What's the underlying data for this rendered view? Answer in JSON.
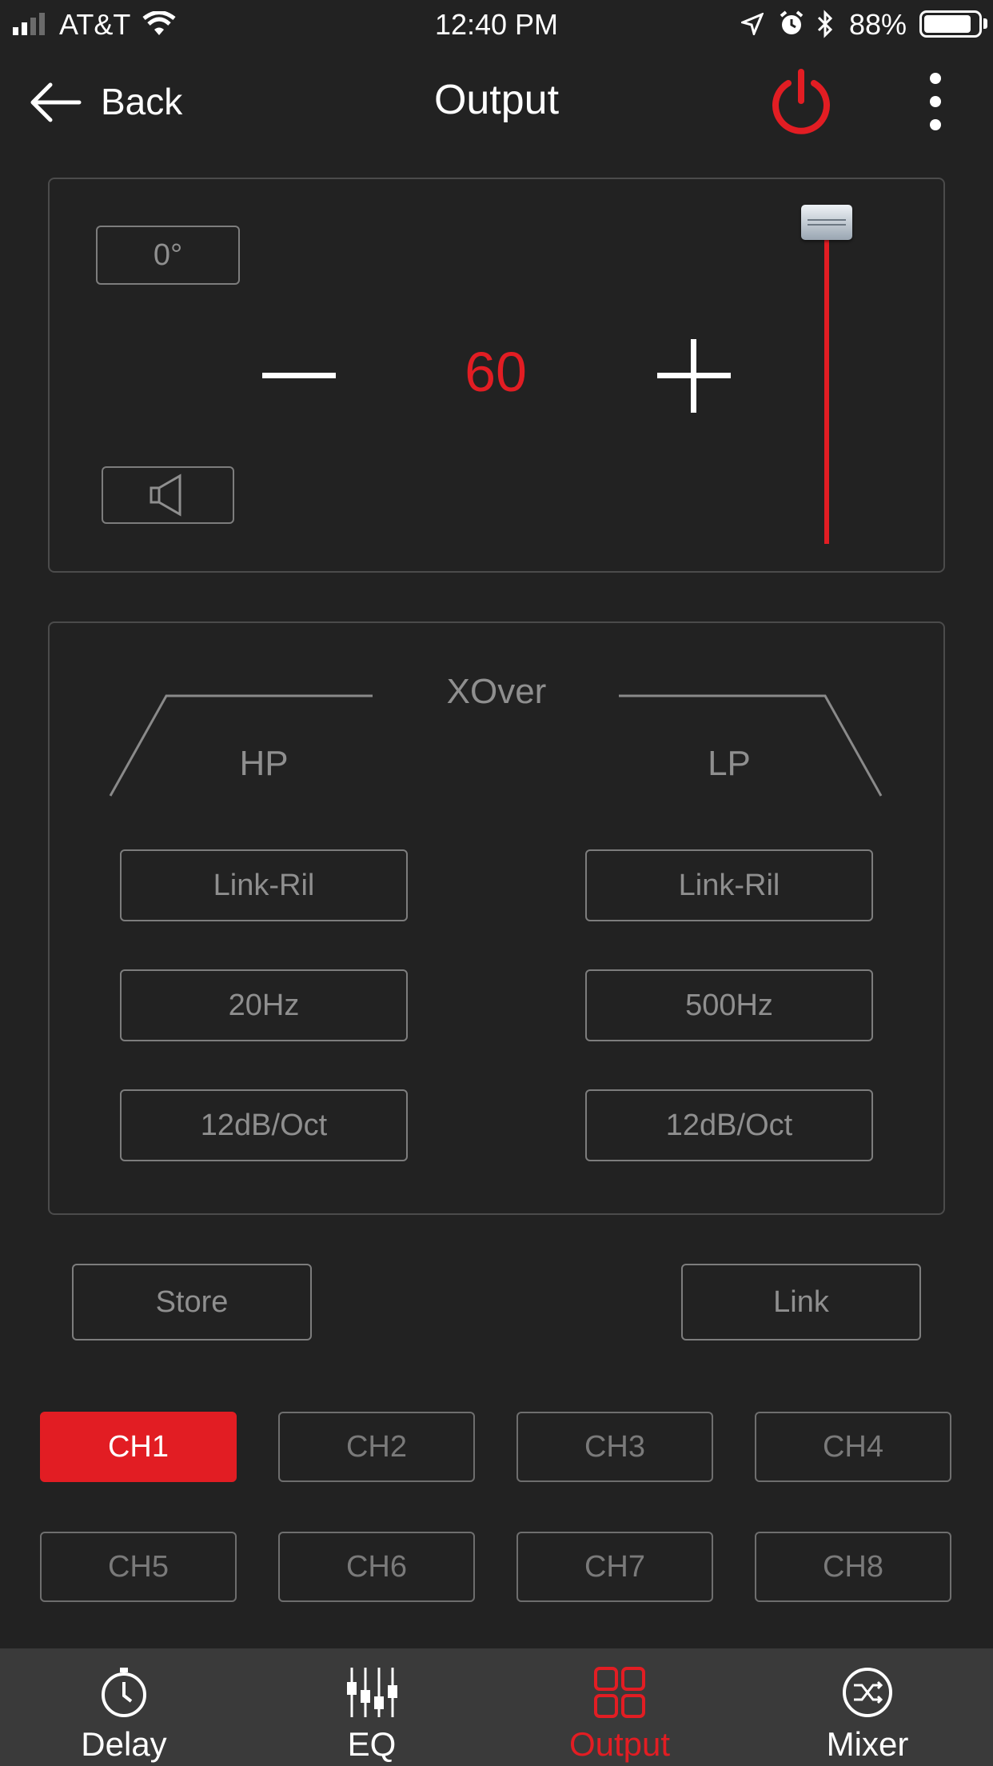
{
  "status_bar": {
    "carrier": "AT&T",
    "time": "12:40 PM",
    "battery": "88%",
    "battery_level": 0.88
  },
  "nav": {
    "back_label": "Back",
    "title": "Output"
  },
  "output_panel": {
    "phase": "0°",
    "level": "60",
    "fader_level": 1.0
  },
  "xover": {
    "title": "XOver",
    "hp": {
      "label": "HP",
      "type": "Link-Ril",
      "freq": "20Hz",
      "slope": "12dB/Oct"
    },
    "lp": {
      "label": "LP",
      "type": "Link-Ril",
      "freq": "500Hz",
      "slope": "12dB/Oct"
    }
  },
  "actions": {
    "store": "Store",
    "link": "Link"
  },
  "channels": [
    "CH1",
    "CH2",
    "CH3",
    "CH4",
    "CH5",
    "CH6",
    "CH7",
    "CH8"
  ],
  "active_channel": "CH1",
  "tabs": [
    {
      "label": "Delay",
      "icon": "clock-icon"
    },
    {
      "label": "EQ",
      "icon": "sliders-icon"
    },
    {
      "label": "Output",
      "icon": "grid-icon"
    },
    {
      "label": "Mixer",
      "icon": "shuffle-bluetooth-icon"
    }
  ],
  "active_tab": "Output",
  "colors": {
    "accent": "#e21d23",
    "background": "#222222",
    "tabbar": "#3a3a3a"
  }
}
